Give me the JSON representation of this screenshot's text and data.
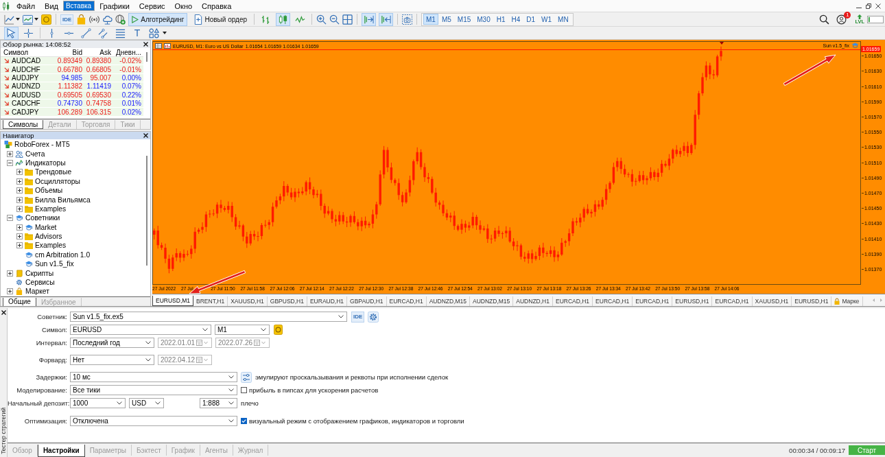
{
  "menu": [
    {
      "label": "Файл",
      "selected": false
    },
    {
      "label": "Вид",
      "selected": false
    },
    {
      "label": "Вставка",
      "selected": true
    },
    {
      "label": "Графики",
      "selected": false
    },
    {
      "label": "Сервис",
      "selected": false
    },
    {
      "label": "Окно",
      "selected": false
    },
    {
      "label": "Справка",
      "selected": false
    }
  ],
  "toolbar": {
    "ide_label": "IDE",
    "algotrading": {
      "label": "Алготрейдинг",
      "on": true
    },
    "new_order": {
      "label": "Новый ордер"
    },
    "chart_types": [
      {
        "kind": "bars",
        "selected": false
      },
      {
        "kind": "candles",
        "selected": true
      },
      {
        "kind": "line",
        "selected": false
      }
    ],
    "autoscroll": {
      "on": true
    },
    "chart_shift": {
      "on": true
    },
    "timeframes": [
      {
        "label": "M1",
        "selected": true
      },
      {
        "label": "M5",
        "selected": false
      },
      {
        "label": "M15",
        "selected": false
      },
      {
        "label": "M30",
        "selected": false
      },
      {
        "label": "H1",
        "selected": false
      },
      {
        "label": "H4",
        "selected": false
      },
      {
        "label": "D1",
        "selected": false
      },
      {
        "label": "W1",
        "selected": false
      },
      {
        "label": "MN",
        "selected": false
      }
    ],
    "notifications": {
      "badge": "1"
    },
    "level_label": "LVL"
  },
  "drawing_tools": [
    {
      "kind": "cursor",
      "selected": true
    },
    {
      "kind": "crosshair",
      "selected": false
    },
    {
      "kind": "vline",
      "selected": false
    },
    {
      "kind": "hline",
      "selected": false
    },
    {
      "kind": "trendline",
      "selected": false
    },
    {
      "kind": "channel",
      "selected": false
    },
    {
      "kind": "lineset",
      "selected": false
    },
    {
      "kind": "text",
      "label": "T",
      "selected": false
    },
    {
      "kind": "shapes",
      "selected": false
    }
  ],
  "market_watch": {
    "title": "Обзор рынка: 14:08:52",
    "columns": [
      "Символ",
      "Bid",
      "Ask",
      "Дневн..."
    ],
    "rows": [
      {
        "symbol": "AUDCAD",
        "bid": "0.89349",
        "ask": "0.89380",
        "change": "-0.02%",
        "bid_up": false,
        "ask_up": false,
        "change_up": false
      },
      {
        "symbol": "AUDCHF",
        "bid": "0.66780",
        "ask": "0.66805",
        "change": "-0.01%",
        "bid_up": false,
        "ask_up": false,
        "change_up": false
      },
      {
        "symbol": "AUDJPY",
        "bid": "94.985",
        "ask": "95.007",
        "change": "0.00%",
        "bid_up": true,
        "ask_up": false,
        "change_up": true
      },
      {
        "symbol": "AUDNZD",
        "bid": "1.11382",
        "ask": "1.11419",
        "change": "0.07%",
        "bid_up": false,
        "ask_up": true,
        "change_up": true
      },
      {
        "symbol": "AUDUSD",
        "bid": "0.69505",
        "ask": "0.69530",
        "change": "0.22%",
        "bid_up": false,
        "ask_up": false,
        "change_up": true
      },
      {
        "symbol": "CADCHF",
        "bid": "0.74730",
        "ask": "0.74758",
        "change": "0.01%",
        "bid_up": true,
        "ask_up": false,
        "change_up": true
      },
      {
        "symbol": "CADJPY",
        "bid": "106.289",
        "ask": "106.315",
        "change": "0.02%",
        "bid_up": false,
        "ask_up": false,
        "change_up": true
      }
    ],
    "tabs": [
      {
        "label": "Символы",
        "selected": true
      },
      {
        "label": "Детали",
        "selected": false
      },
      {
        "label": "Торговля",
        "selected": false
      },
      {
        "label": "Тики",
        "selected": false
      }
    ]
  },
  "navigator": {
    "title": "Навигатор",
    "tree": [
      {
        "kind": "broker",
        "label": "RoboForex - MT5",
        "children": [
          {
            "kind": "accounts",
            "label": "Счета",
            "expanded": false
          },
          {
            "kind": "indicators",
            "label": "Индикаторы",
            "expanded": true,
            "children": [
              {
                "kind": "folder",
                "label": "Трендовые",
                "expanded": false
              },
              {
                "kind": "folder",
                "label": "Осцилляторы",
                "expanded": false
              },
              {
                "kind": "folder",
                "label": "Объемы",
                "expanded": false
              },
              {
                "kind": "folder",
                "label": "Билла Вильямса",
                "expanded": false
              },
              {
                "kind": "folder",
                "label": "Examples",
                "expanded": false
              }
            ]
          },
          {
            "kind": "experts",
            "label": "Советники",
            "expanded": true,
            "children": [
              {
                "kind": "expert",
                "label": "Market",
                "expanded": false
              },
              {
                "kind": "folder",
                "label": "Advisors",
                "expanded": false
              },
              {
                "kind": "folder",
                "label": "Examples",
                "expanded": false
              },
              {
                "kind": "expert",
                "label": "cm Arbitration 1.0"
              },
              {
                "kind": "expert",
                "label": "Sun v1.5_fix"
              }
            ]
          },
          {
            "kind": "scripts",
            "label": "Скрипты",
            "expanded": false
          },
          {
            "kind": "services",
            "label": "Сервисы"
          },
          {
            "kind": "market",
            "label": "Маркет",
            "expanded": false
          }
        ]
      }
    ],
    "tabs": [
      {
        "label": "Общие",
        "selected": true
      },
      {
        "label": "Избранное",
        "selected": false
      }
    ]
  },
  "chart": {
    "title": "EURUSD, M1: Euro vs US Dollar",
    "quotes": "1.01654 1.01659 1.01634 1.01659",
    "expert": "Sun v1.5_fix",
    "current_price": "1.01659",
    "price_axis": [
      "1.01650",
      "1.01630",
      "1.01610",
      "1.01590",
      "1.01570",
      "1.01550",
      "1.01530",
      "1.01510",
      "1.01490",
      "1.01470",
      "1.01450",
      "1.01430",
      "1.01410",
      "1.01390",
      "1.01370"
    ],
    "time_axis": [
      "27 Jul 2022",
      "27 Jul",
      "27 Jul 11:50",
      "27 Jul 11:58",
      "27 Jul 12:06",
      "27 Jul 12:14",
      "27 Jul 12:22",
      "27 Jul 12:30",
      "27 Jul 12:38",
      "27 Jul 12:46",
      "27 Jul 12:54",
      "27 Jul 13:02",
      "27 Jul 13:10",
      "27 Jul 13:18",
      "27 Jul 13:26",
      "27 Jul 13:34",
      "27 Jul 13:42",
      "27 Jul 13:50",
      "27 Jul 13:58",
      "27 Jul 14:06"
    ]
  },
  "chart_tabs": [
    {
      "label": "EURUSD,M1",
      "selected": true,
      "locked": false
    },
    {
      "label": "BRENT,H1",
      "selected": false,
      "locked": false
    },
    {
      "label": "XAUUSD,H1",
      "selected": false,
      "locked": false
    },
    {
      "label": "GBPUSD,H1",
      "selected": false,
      "locked": false
    },
    {
      "label": "EURAUD,H1",
      "selected": false,
      "locked": false
    },
    {
      "label": "GBPAUD,H1",
      "selected": false,
      "locked": false
    },
    {
      "label": "EURCAD,H1",
      "selected": false,
      "locked": false
    },
    {
      "label": "AUDNZD,M15",
      "selected": false,
      "locked": false
    },
    {
      "label": "AUDNZD,M15",
      "selected": false,
      "locked": false
    },
    {
      "label": "AUDNZD,H1",
      "selected": false,
      "locked": false
    },
    {
      "label": "EURCAD,H1",
      "selected": false,
      "locked": false
    },
    {
      "label": "EURCAD,H1",
      "selected": false,
      "locked": false
    },
    {
      "label": "EURCAD,H1",
      "selected": false,
      "locked": false
    },
    {
      "label": "EURUSD,H1",
      "selected": false,
      "locked": false
    },
    {
      "label": "EURCAD,H1",
      "selected": false,
      "locked": false
    },
    {
      "label": "XAUUSD,H1",
      "selected": false,
      "locked": false
    },
    {
      "label": "EURUSD,H1",
      "selected": false,
      "locked": false
    },
    {
      "label": "Марке",
      "selected": false,
      "locked": true
    }
  ],
  "tester": {
    "title": "Тестер стратегий",
    "expert": {
      "label": "Советник:",
      "value": "Sun v1.5_fix.ex5",
      "ide_label": "IDE"
    },
    "symbol": {
      "label": "Символ:",
      "value": "EURUSD",
      "timeframe": "M1"
    },
    "interval": {
      "label": "Интервал:",
      "value": "Последний год",
      "dates": [
        {
          "value": "2022.01.01",
          "disabled": true
        },
        {
          "value": "2022.07.26",
          "disabled": true
        }
      ]
    },
    "forward": {
      "label": "Форвард:",
      "value": "Нет",
      "dates": [
        {
          "value": "2022.04.12",
          "disabled": true
        }
      ]
    },
    "delays": {
      "label": "Задержки:",
      "value": "10 мс",
      "note": "эмулируют проскальзывания и реквоты при исполнении сделок"
    },
    "modeling": {
      "label": "Моделирование:",
      "value": "Все тики",
      "option": {
        "label": "прибыль в пипсах для ускорения расчетов",
        "checked": false
      }
    },
    "deposit": {
      "label": "Начальный депозит:",
      "value": "1000",
      "currency": "USD",
      "leverage": "1:888",
      "leverage_label": "плечо"
    },
    "optimization": {
      "label": "Оптимизация:",
      "value": "Отключена",
      "option": {
        "label": "визуальный режим с отображением графиков, индикаторов и торговли",
        "checked": true
      }
    },
    "tabs": [
      {
        "label": "Обзор",
        "selected": false
      },
      {
        "label": "Настройки",
        "selected": true
      },
      {
        "label": "Параметры",
        "selected": false
      },
      {
        "label": "Бэктест",
        "selected": false
      },
      {
        "label": "График",
        "selected": false
      },
      {
        "label": "Агенты",
        "selected": false
      },
      {
        "label": "Журнал",
        "selected": false
      }
    ],
    "progress": "00:00:34 / 00:09:17",
    "start_button": "Старт"
  }
}
